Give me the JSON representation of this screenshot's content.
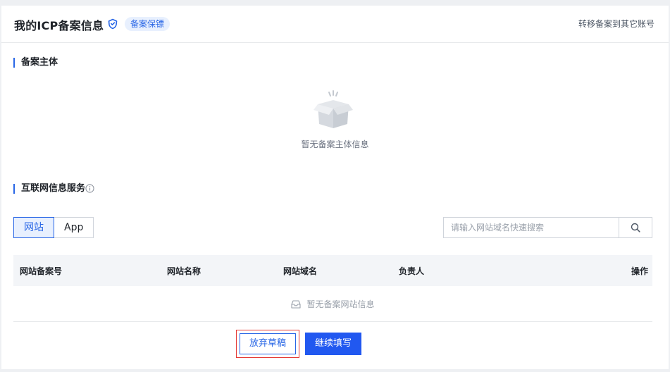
{
  "header": {
    "title": "我的ICP备案信息",
    "badge": "备案保镖",
    "transfer_link": "转移备案到其它账号"
  },
  "section_subject": {
    "title": "备案主体",
    "empty_text": "暂无备案主体信息"
  },
  "section_services": {
    "title": "互联网信息服务",
    "tabs": [
      {
        "label": "网站",
        "active": true
      },
      {
        "label": "App",
        "active": false
      }
    ],
    "search": {
      "placeholder": "请输入网站域名快速搜索",
      "value": ""
    },
    "table": {
      "columns": [
        "网站备案号",
        "网站名称",
        "网站域名",
        "负责人",
        "操作"
      ],
      "rows": [],
      "empty_text": "暂无备案网站信息"
    }
  },
  "actions": {
    "discard_label": "放弃草稿",
    "continue_label": "继续填写"
  },
  "colors": {
    "accent": "#2866e6",
    "primary_button": "#2158f0",
    "highlight_border": "#e53935"
  },
  "icons": [
    "shield-icon",
    "info-icon",
    "empty-box-icon",
    "search-icon",
    "empty-tray-icon"
  ]
}
